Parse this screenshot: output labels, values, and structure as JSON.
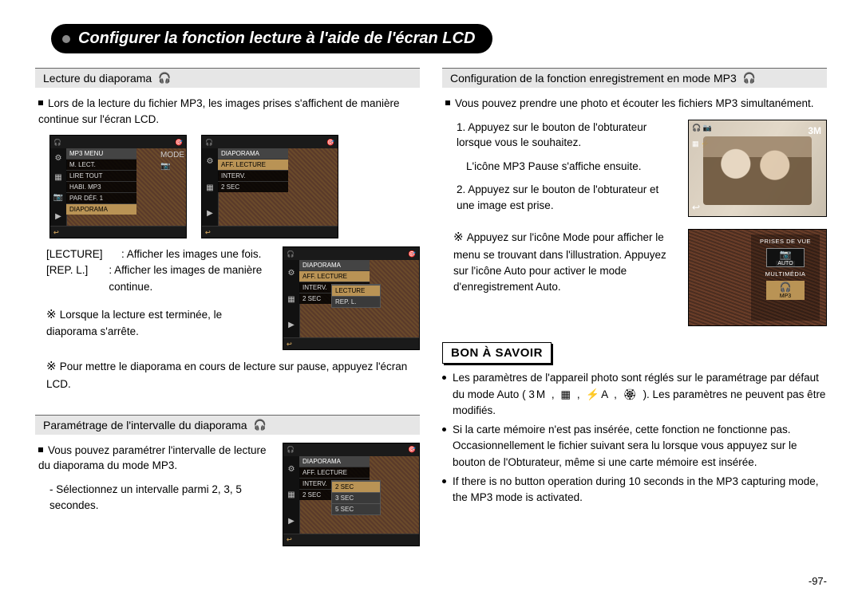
{
  "page": {
    "title": "Configurer la fonction lecture à l'aide de l'écran LCD",
    "number": "-97-"
  },
  "left": {
    "section1": {
      "header": "Lecture du diaporama",
      "intro": "Lors de la lecture du fichier MP3, les images prises s'affichent de manière continue sur l'écran LCD.",
      "lcd1": {
        "title": "MP3 MENU",
        "items": [
          "M. LECT.",
          "LIRE TOUT",
          "HABI. MP3",
          "PAR DÉF. 1"
        ],
        "selected": "DIAPORAMA",
        "mode_label": "MODE"
      },
      "lcd2": {
        "title": "DIAPORAMA",
        "items": [
          "AFF. LECTURE",
          "INTERV.",
          "2 SEC"
        ]
      },
      "defs": {
        "lecture_key": "[LECTURE]",
        "lecture_val": ": Afficher les images une fois.",
        "rep_key": "[REP. L.]",
        "rep_val": ": Afficher les images de manière continue."
      },
      "lcd3": {
        "title": "DIAPORAMA",
        "items": [
          "AFF. LECTURE",
          "INTERV.",
          "2 SEC"
        ],
        "submenu": [
          "LECTURE",
          "REP. L."
        ]
      },
      "note1": "Lorsque la lecture est terminée, le diaporama s'arrête.",
      "note2": "Pour mettre le diaporama en cours de lecture sur pause, appuyez l'écran LCD."
    },
    "section2": {
      "header": "Paramétrage de l'intervalle du diaporama",
      "intro": "Vous pouvez paramétrer l'intervalle de lecture du diaporama du mode MP3.",
      "sub": "- Sélectionnez un intervalle parmi 2, 3, 5 secondes.",
      "lcd": {
        "title": "DIAPORAMA",
        "items": [
          "AFF. LECTURE",
          "INTERV.",
          "2 SEC"
        ],
        "submenu": [
          "2 SEC",
          "3 SEC",
          "5 SEC"
        ]
      }
    }
  },
  "right": {
    "section": {
      "header": "Configuration de la fonction enregistrement en mode MP3",
      "intro": "Vous pouvez prendre une photo et écouter les fichiers MP3 simultanément.",
      "step1": "1. Appuyez sur le bouton de l'obturateur lorsque vous le souhaitez.",
      "step1b": "L'icône MP3 Pause s'affiche ensuite.",
      "step2": "2. Appuyez sur le bouton de l'obturateur et une image est prise.",
      "note": "Appuyez sur l'icône Mode pour afficher le menu se trouvant dans l'illustration. Appuyez sur l'icône Auto pour activer le mode d'enregistrement Auto.",
      "photo": {
        "top_left_icons": "🎧 📷",
        "top_right": "3M",
        "side_icons": "▦ ⚡",
        "corner": "↩"
      },
      "mode_lcd": {
        "title": "PRISES DE VUE",
        "cam_sub": "AUTO",
        "multi": "MULTIMÉDIA",
        "mp3": "MP3"
      }
    },
    "bon": {
      "title": "BON À SAVOIR",
      "b1a": "Les paramètres de l'appareil photo sont réglés sur le paramétrage par défaut du mode Auto (",
      "b1icons": " 3M ,  ▦ ,  ⚡A ,  🏵 ",
      "b1b": "). Les paramètres ne peuvent pas être modifiés.",
      "b2": "Si la carte mémoire n'est pas insérée, cette fonction ne fonctionne pas. Occasionnellement le fichier suivant sera lu lorsque vous appuyez sur le bouton de l'Obturateur, même si une carte mémoire est insérée.",
      "b3": "If there is no button operation during 10 seconds in the MP3 capturing mode, the MP3 mode is activated."
    }
  }
}
